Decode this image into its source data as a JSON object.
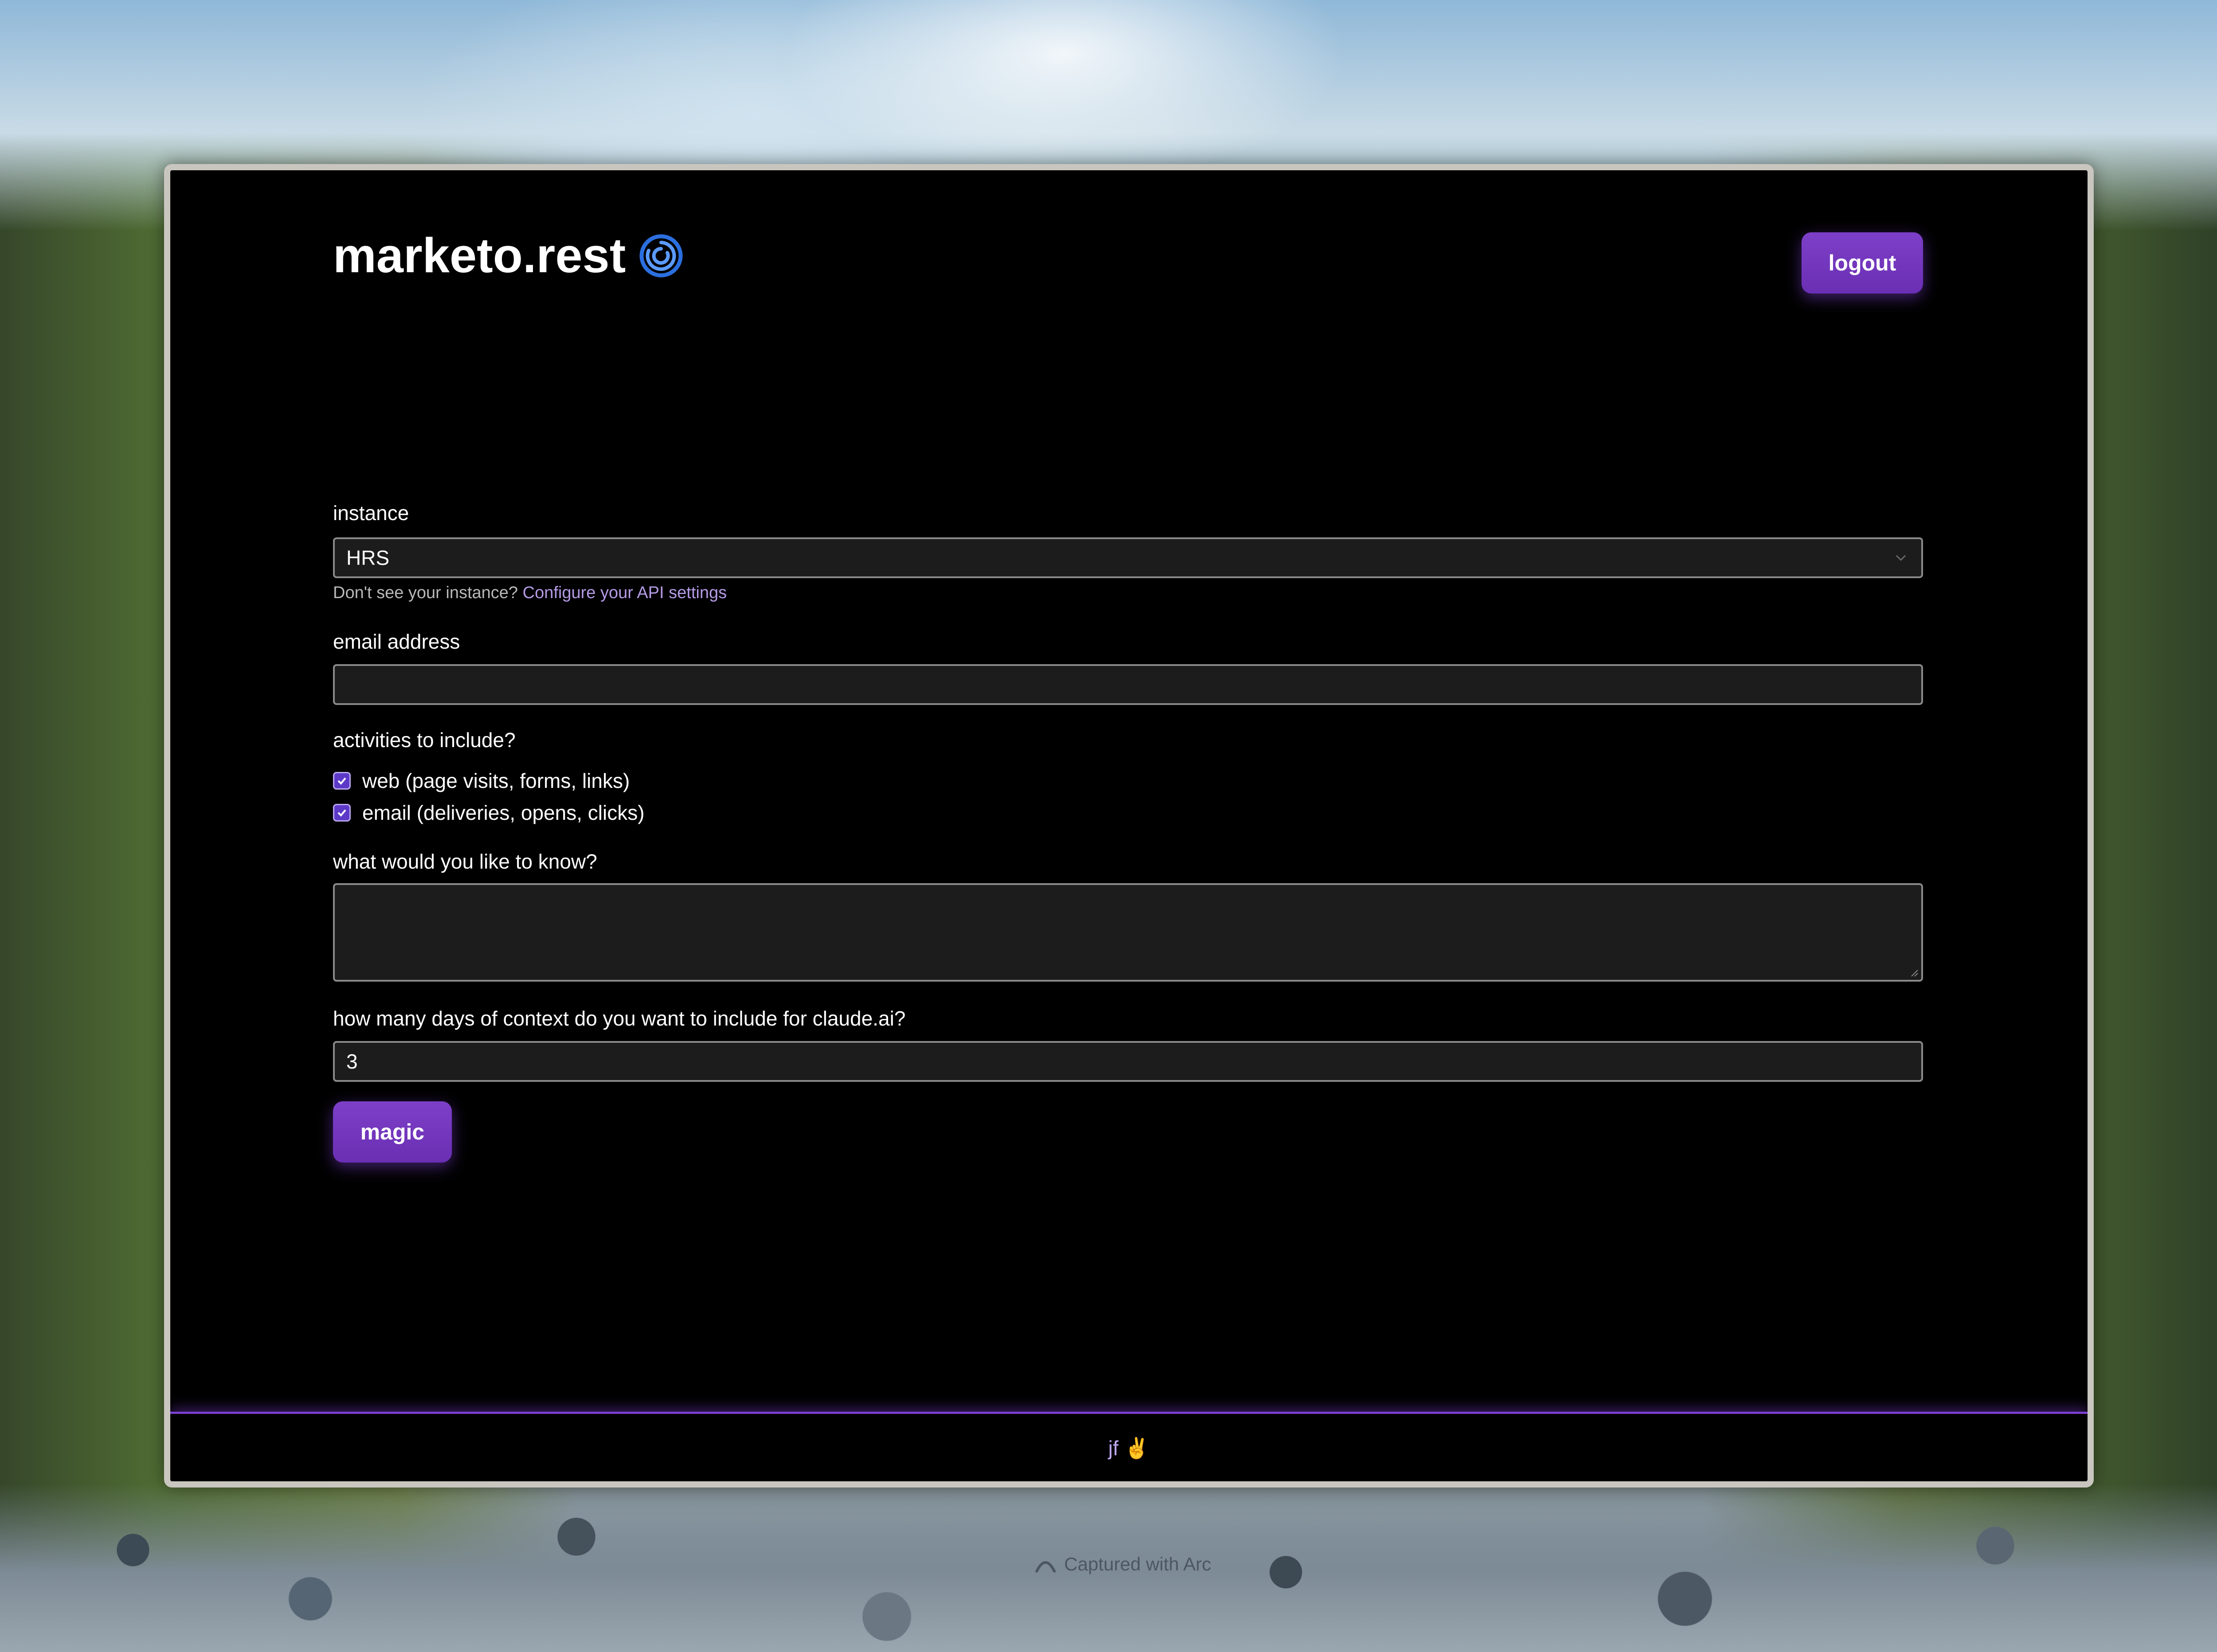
{
  "header": {
    "title": "marketo.rest",
    "title_icon": "spiral-icon",
    "logout_label": "logout"
  },
  "form": {
    "instance": {
      "label": "instance",
      "value": "HRS",
      "help_prefix": "Don't see your instance?",
      "help_link": "Configure your API settings"
    },
    "email": {
      "label": "email address",
      "value": ""
    },
    "activities": {
      "label": "activities to include?",
      "options": [
        {
          "label": "web (page visits, forms, links)",
          "checked": true
        },
        {
          "label": "email (deliveries, opens, clicks)",
          "checked": true
        }
      ]
    },
    "question": {
      "label": "what would you like to know?",
      "value": ""
    },
    "days": {
      "label": "how many days of context do you want to include for claude.ai?",
      "value": "3"
    },
    "submit_label": "magic"
  },
  "footer": {
    "text": "jf ✌️"
  },
  "overlay": {
    "captured": "Captured with Arc"
  },
  "colors": {
    "accent": "#7b3fd0",
    "button": "#6d31b8",
    "link": "#b59be6",
    "checkbox": "#5d39c8"
  }
}
